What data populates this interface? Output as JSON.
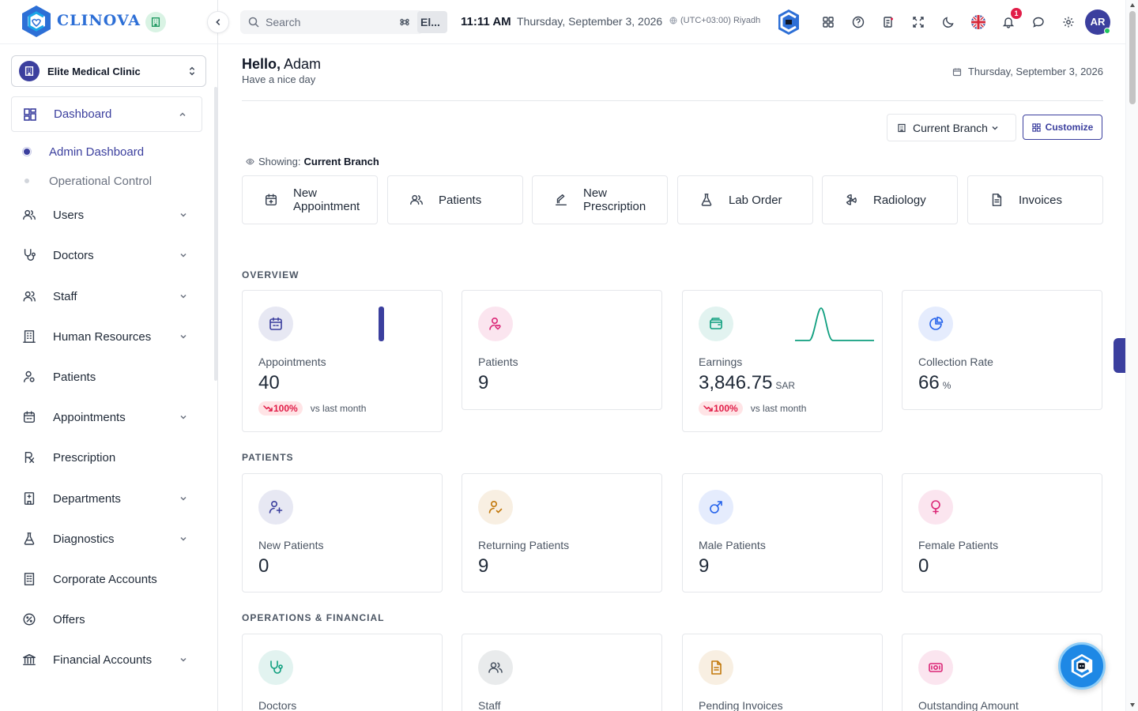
{
  "brand": {
    "name": "CLINOVA"
  },
  "clinic": {
    "name": "Elite Medical Clinic"
  },
  "sidebar": {
    "dashboard": {
      "label": "Dashboard",
      "icon": "dashboard-grid-icon"
    },
    "sub_items": [
      {
        "label": "Admin Dashboard",
        "active": true
      },
      {
        "label": "Operational Control",
        "active": false
      }
    ],
    "items": [
      {
        "label": "Users",
        "icon": "users-icon",
        "has_chevron": true
      },
      {
        "label": "Doctors",
        "icon": "stethoscope-icon",
        "has_chevron": true
      },
      {
        "label": "Staff",
        "icon": "staff-icon",
        "has_chevron": true
      },
      {
        "label": "Human Resources",
        "icon": "building-icon",
        "has_chevron": true
      },
      {
        "label": "Patients",
        "icon": "patient-icon",
        "has_chevron": false
      },
      {
        "label": "Appointments",
        "icon": "calendar-icon",
        "has_chevron": true
      },
      {
        "label": "Prescription",
        "icon": "prescription-icon",
        "has_chevron": false
      },
      {
        "label": "Departments",
        "icon": "hospital-icon",
        "has_chevron": true
      },
      {
        "label": "Diagnostics",
        "icon": "flask-icon",
        "has_chevron": true
      },
      {
        "label": "Corporate Accounts",
        "icon": "corporate-icon",
        "has_chevron": false
      },
      {
        "label": "Offers",
        "icon": "percent-icon",
        "has_chevron": false
      },
      {
        "label": "Financial Accounts",
        "icon": "bank-icon",
        "has_chevron": true
      }
    ]
  },
  "topbar": {
    "search_placeholder": "Search",
    "branch_chip": "El...",
    "time": "11:11 AM",
    "date": "Thursday, September 3, 2026",
    "timezone": "(UTC+03:00) Riyadh",
    "notifications_count": "1",
    "user_initials": "AR"
  },
  "header": {
    "greeting_prefix": "Hello,",
    "user_name": "Adam",
    "subtitle": "Have a nice day",
    "today": "Thursday, September 3, 2026"
  },
  "controls": {
    "branch_label": "Current Branch",
    "customize_label": "Customize",
    "showing_prefix": "Showing:",
    "showing_value": "Current Branch"
  },
  "quick_actions": [
    {
      "label": "New Appointment",
      "icon": "calendar-plus-icon"
    },
    {
      "label": "Patients",
      "icon": "users-icon"
    },
    {
      "label": "New Prescription",
      "icon": "prescription-pen-icon"
    },
    {
      "label": "Lab Order",
      "icon": "flask-icon"
    },
    {
      "label": "Radiology",
      "icon": "radiation-icon"
    },
    {
      "label": "Invoices",
      "icon": "document-icon"
    }
  ],
  "sections": {
    "overview": "OVERVIEW",
    "patients": "PATIENTS",
    "operations": "OPERATIONS & FINANCIAL"
  },
  "overview_cards": [
    {
      "label": "Appointments",
      "value": "40",
      "trend": "100%",
      "trend_text": "vs last month",
      "icon": "calendar-icon",
      "color": "#3b3f9e"
    },
    {
      "label": "Patients",
      "value": "9",
      "icon": "patient-heart-icon",
      "color": "#db2777"
    },
    {
      "label": "Earnings",
      "value": "3,846.75",
      "unit": "SAR",
      "trend": "100%",
      "trend_text": "vs last month",
      "icon": "wallet-icon",
      "color": "#0f9f7f"
    },
    {
      "label": "Collection Rate",
      "value": "66",
      "unit": "%",
      "icon": "pie-chart-icon",
      "color": "#2563eb"
    }
  ],
  "patient_cards": [
    {
      "label": "New Patients",
      "value": "0",
      "icon": "user-plus-icon",
      "color": "#3b3f9e"
    },
    {
      "label": "Returning Patients",
      "value": "9",
      "icon": "user-check-icon",
      "color": "#c2780b"
    },
    {
      "label": "Male Patients",
      "value": "9",
      "icon": "male-icon",
      "color": "#2563eb"
    },
    {
      "label": "Female Patients",
      "value": "0",
      "icon": "female-icon",
      "color": "#db2777"
    }
  ],
  "operations_cards": [
    {
      "label": "Doctors",
      "icon": "stethoscope-icon",
      "color": "#0f9f7f"
    },
    {
      "label": "Staff",
      "icon": "users-icon",
      "color": "#4b5563"
    },
    {
      "label": "Pending Invoices",
      "icon": "invoice-icon",
      "color": "#c2780b"
    },
    {
      "label": "Outstanding Amount",
      "icon": "cash-icon",
      "color": "#db2777"
    }
  ]
}
